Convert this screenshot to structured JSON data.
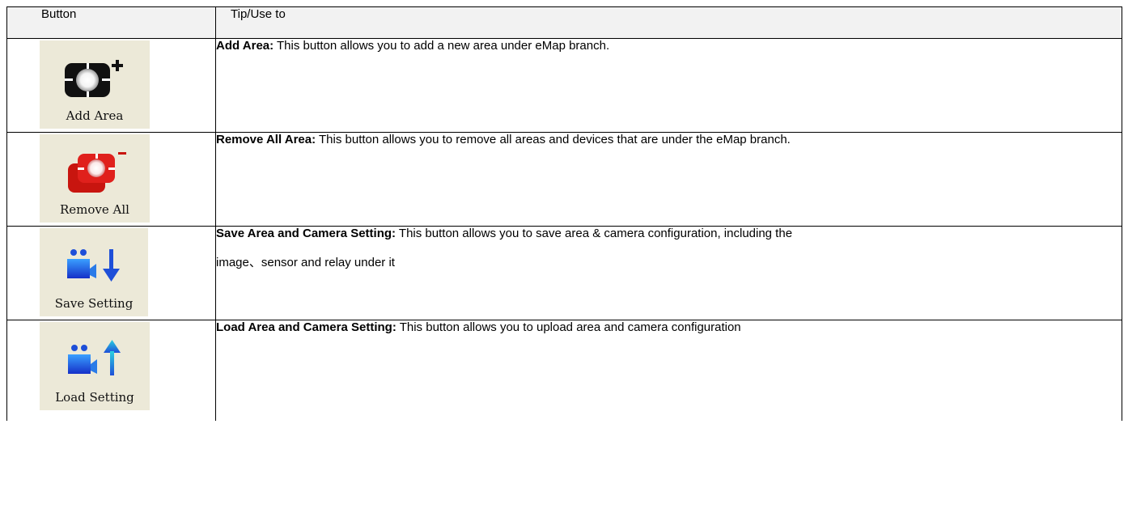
{
  "header": {
    "col_button": "Button",
    "col_tip": "Tip/Use to"
  },
  "rows": [
    {
      "button_label": "Add Area",
      "icon": "add-area-icon",
      "tip_title": "Add Area:",
      "tip_text": " This button allows you to add a new area under eMap branch.",
      "tip_text2": ""
    },
    {
      "button_label": "Remove All",
      "icon": "remove-all-icon",
      "tip_title": "Remove All Area:",
      "tip_text": " This button allows you to remove all areas and devices that are under the eMap branch.",
      "tip_text2": ""
    },
    {
      "button_label": "Save Setting",
      "icon": "save-setting-icon",
      "tip_title": "Save Area and Camera Setting:",
      "tip_text": " This button allows you to save area & camera configuration, including the",
      "tip_text2": "image、sensor and relay under it"
    },
    {
      "button_label": "Load Setting",
      "icon": "load-setting-icon",
      "tip_title": "Load Area and Camera Setting:",
      "tip_text": " This button allows you to upload area and camera configuration",
      "tip_text2": ""
    }
  ],
  "colors": {
    "toolbar_bg": "#ece9d8",
    "header_bg": "#f2f2f2",
    "remove_red": "#e0201c",
    "camera_blue": "#1e4fd8"
  }
}
